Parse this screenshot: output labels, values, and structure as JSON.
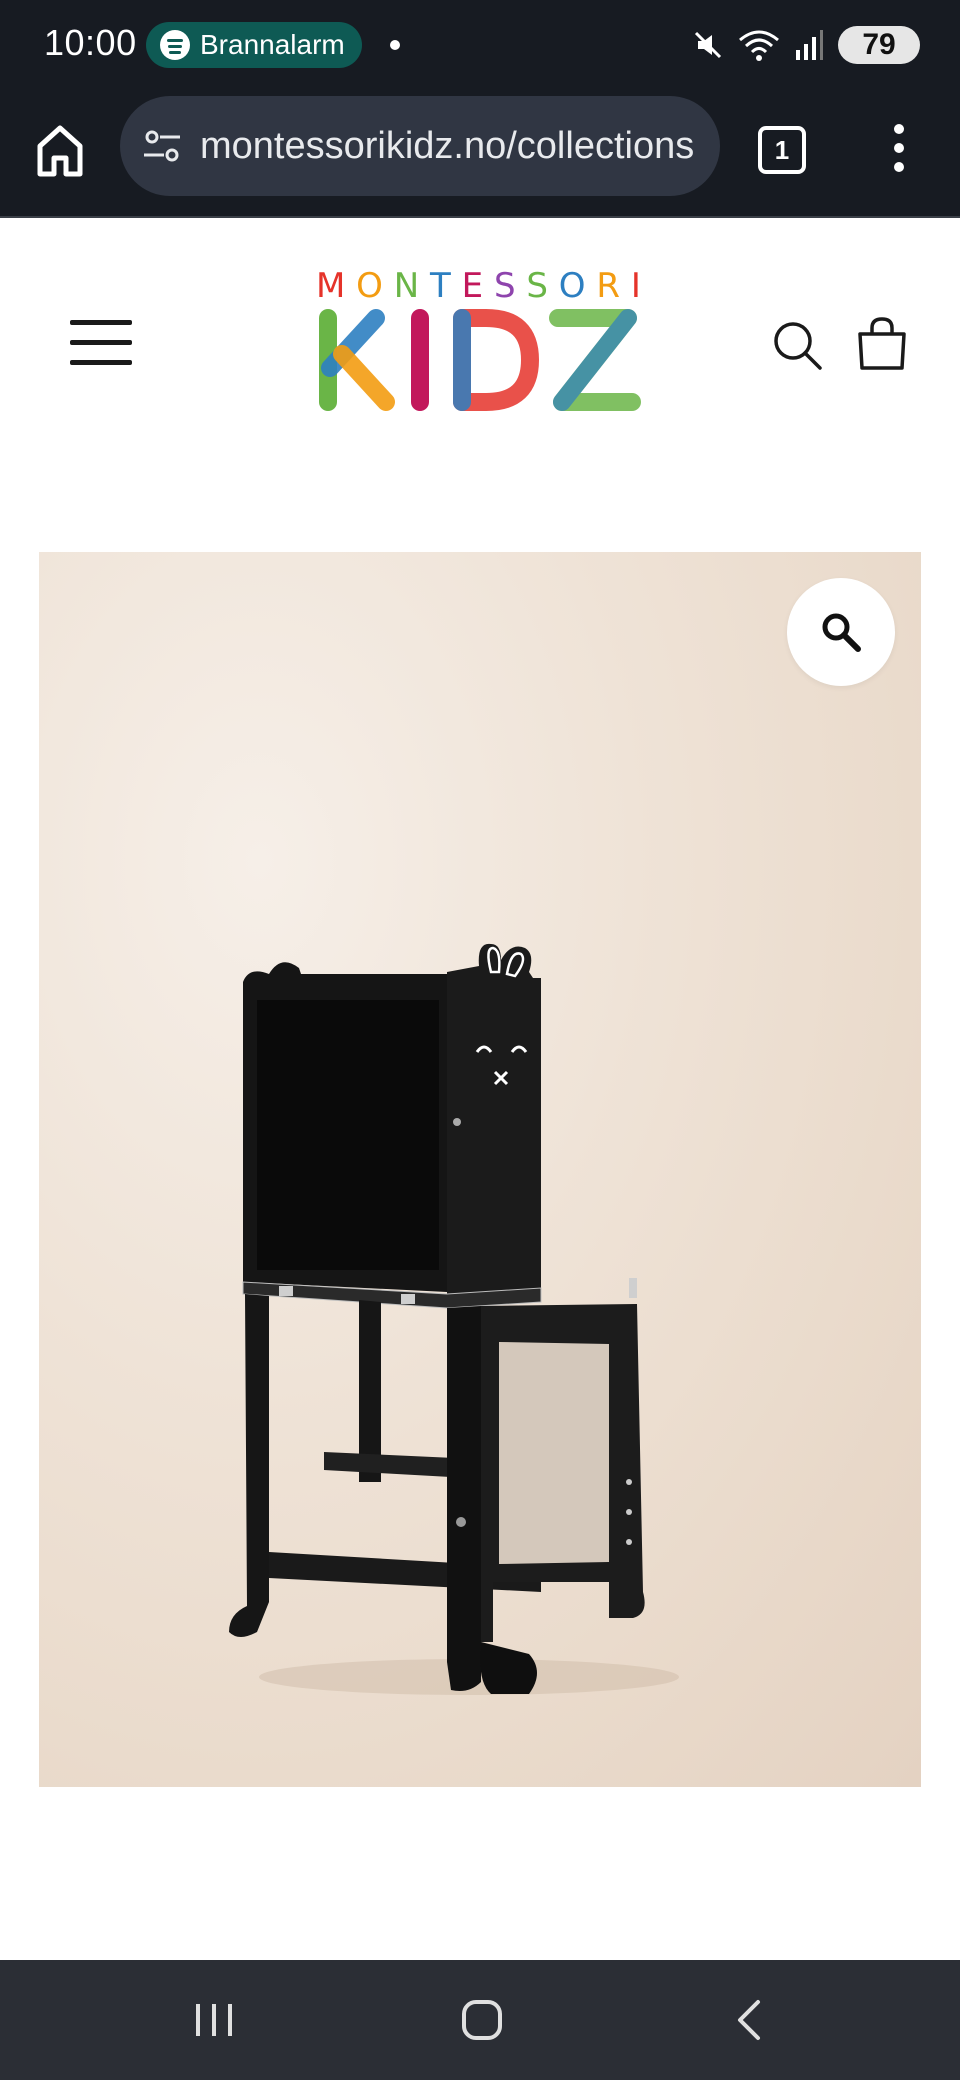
{
  "status_bar": {
    "time": "10:00",
    "notification_label": "Brannalarm",
    "battery_level": "79",
    "icons": [
      "spotify-icon",
      "mute-icon",
      "wifi-icon",
      "signal-icon",
      "battery-icon"
    ]
  },
  "browser": {
    "url": "montessorikidz.no/collections",
    "tab_count": "1",
    "icons": [
      "home-icon",
      "site-settings-icon",
      "tabs-icon",
      "more-menu-icon"
    ]
  },
  "site": {
    "logo_top": "MONTESSORI",
    "logo_main": "KIDZ",
    "icons": [
      "hamburger-menu-icon",
      "search-icon",
      "shopping-bag-icon"
    ]
  },
  "product": {
    "image_subject": "black learning tower with bunny face and chalkboard",
    "zoom_icon": "magnifier-icon"
  },
  "nav_bar": {
    "icons": [
      "recent-apps-icon",
      "home-icon",
      "back-icon"
    ]
  },
  "colors": {
    "status_bg": "#171b22",
    "url_box_bg": "#303643",
    "spotify_pill": "#0e5a54",
    "nav_bg": "#2b2e35",
    "logo_colors": [
      "#e5332a",
      "#f39c12",
      "#6ab547",
      "#2d7fc1",
      "#c2185b",
      "#8e44ad"
    ]
  }
}
